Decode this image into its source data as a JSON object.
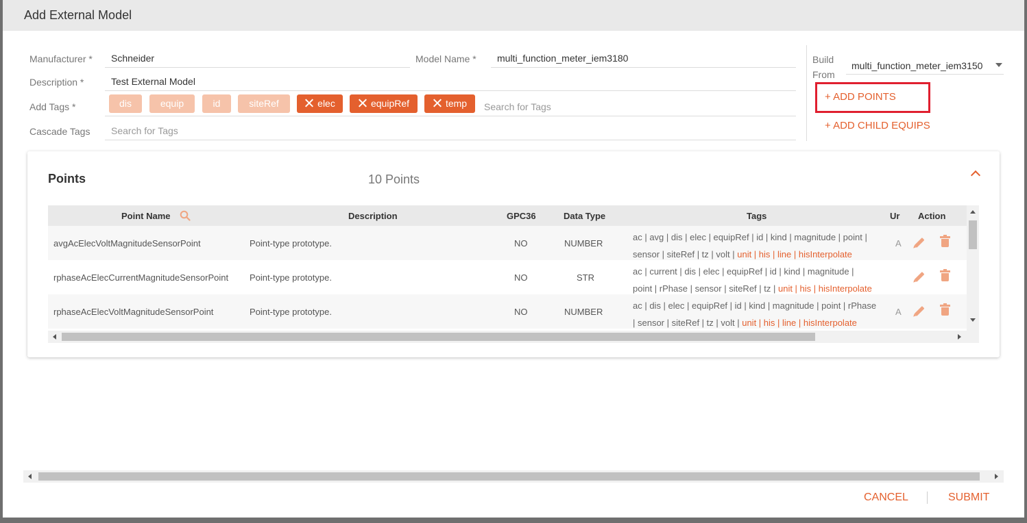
{
  "dialog": {
    "title": "Add External Model"
  },
  "form": {
    "manufacturer": {
      "label": "Manufacturer",
      "value": "Schneider"
    },
    "model_name": {
      "label": "Model Name",
      "value": "multi_function_meter_iem3180"
    },
    "description": {
      "label": "Description",
      "value": "Test External Model"
    },
    "add_tags": {
      "label": "Add Tags",
      "placeholder": "Search for Tags",
      "default_tags": [
        "dis",
        "equip",
        "id",
        "siteRef"
      ],
      "removable_tags": [
        "elec",
        "equipRef",
        "temp"
      ]
    },
    "cascade_tags": {
      "label": "Cascade Tags",
      "placeholder": "Search for Tags"
    },
    "required_marker": "*"
  },
  "build_from": {
    "label_line1": "Build",
    "label_line2": "From",
    "value": "multi_function_meter_iem3150"
  },
  "actions": {
    "add_points": "+ ADD POINTS",
    "add_child_equips": "+ ADD CHILD EQUIPS"
  },
  "points": {
    "title": "Points",
    "count_label": "10 Points",
    "columns": {
      "point_name": "Point Name",
      "description": "Description",
      "gpc36": "GPC36",
      "data_type": "Data Type",
      "tags": "Tags",
      "unit": "Ur",
      "action": "Action"
    },
    "rows": [
      {
        "name": "avgAcElecVoltMagnitudeSensorPoint",
        "description": "Point-type prototype.",
        "gpc36": "NO",
        "data_type": "NUMBER",
        "tags_line1": "ac | avg | dis | elec | equipRef | id | kind | magnitude | point |",
        "tags_line2": "sensor | siteRef | tz | volt | ",
        "tags_hl": "unit | his | line | hisInterpolate",
        "unit": "A"
      },
      {
        "name": "rphaseAcElecCurrentMagnitudeSensorPoint",
        "description": "Point-type prototype.",
        "gpc36": "NO",
        "data_type": "STR",
        "tags_line1": "ac | current | dis | elec | equipRef | id | kind | magnitude |",
        "tags_line2": "point | rPhase | sensor | siteRef | tz | ",
        "tags_hl": "unit | his | hisInterpolate",
        "unit": ""
      },
      {
        "name": "rphaseAcElecVoltMagnitudeSensorPoint",
        "description": "Point-type prototype.",
        "gpc36": "NO",
        "data_type": "NUMBER",
        "tags_line1": "ac | dis | elec | equipRef | id | kind | magnitude | point | rPhase",
        "tags_line2": "| sensor | siteRef | tz | volt | ",
        "tags_hl": "unit | his | line | hisInterpolate",
        "unit": "A"
      }
    ]
  },
  "footer": {
    "cancel": "CANCEL",
    "submit": "SUBMIT"
  },
  "colors": {
    "accent": "#e4602e",
    "tag_light": "#f6c3aa",
    "highlight_box": "#e01f2f"
  },
  "icons": [
    "search-icon",
    "close-icon",
    "chevron-down-icon",
    "chevron-up-icon",
    "edit-icon",
    "trash-icon"
  ]
}
